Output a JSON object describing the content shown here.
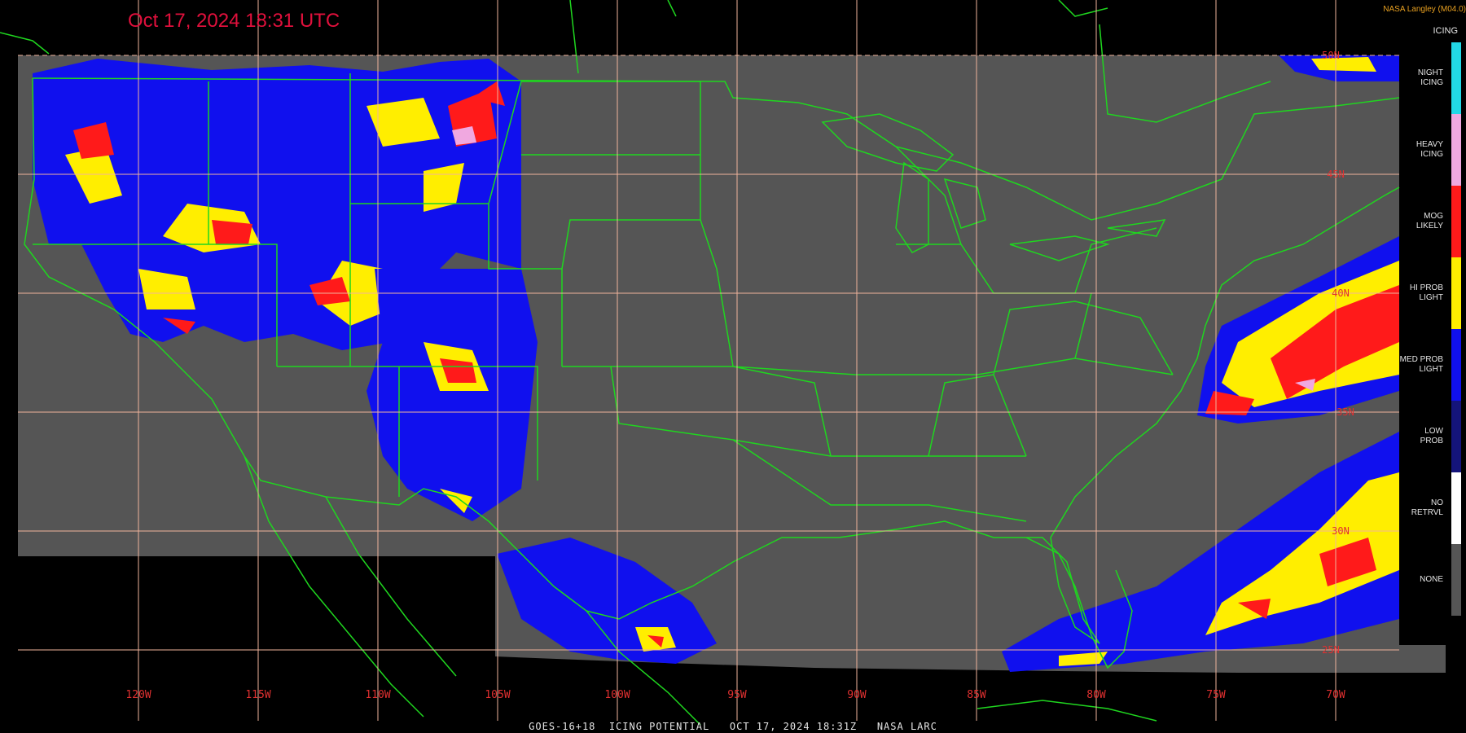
{
  "header": {
    "timestamp": "Oct 17, 2024 18:31 UTC",
    "credit": "NASA Langley (M04.0)"
  },
  "footer": {
    "caption": "GOES-16+18  ICING POTENTIAL   OCT 17, 2024 18:31Z   NASA LARC"
  },
  "graticule": {
    "longitudes": [
      "120W",
      "115W",
      "110W",
      "105W",
      "100W",
      "95W",
      "90W",
      "85W",
      "80W",
      "75W",
      "70W"
    ],
    "latitudes": [
      "50N",
      "45N",
      "40N",
      "35N",
      "30N",
      "25N"
    ],
    "line_color": "#f0b49c"
  },
  "legend": {
    "heading": "ICING",
    "items": [
      {
        "label": "NIGHT\nICING",
        "color": "#22d8e6"
      },
      {
        "label": "HEAVY\nICING",
        "color": "#f0a8e0"
      },
      {
        "label": "MOG\nLIKELY",
        "color": "#ff1a1a"
      },
      {
        "label": "HI PROB\nLIGHT",
        "color": "#ffee00"
      },
      {
        "label": "MED PROB\nLIGHT",
        "color": "#1010ee"
      },
      {
        "label": "LOW\nPROB",
        "color": "#14147a"
      },
      {
        "label": "NO\nRETRVL",
        "color": "#ffffff"
      },
      {
        "label": "NONE",
        "color": "#555555"
      }
    ]
  },
  "colors": {
    "background": "#000000",
    "no_icing": "#555555",
    "boundaries": "#1fd61f"
  }
}
